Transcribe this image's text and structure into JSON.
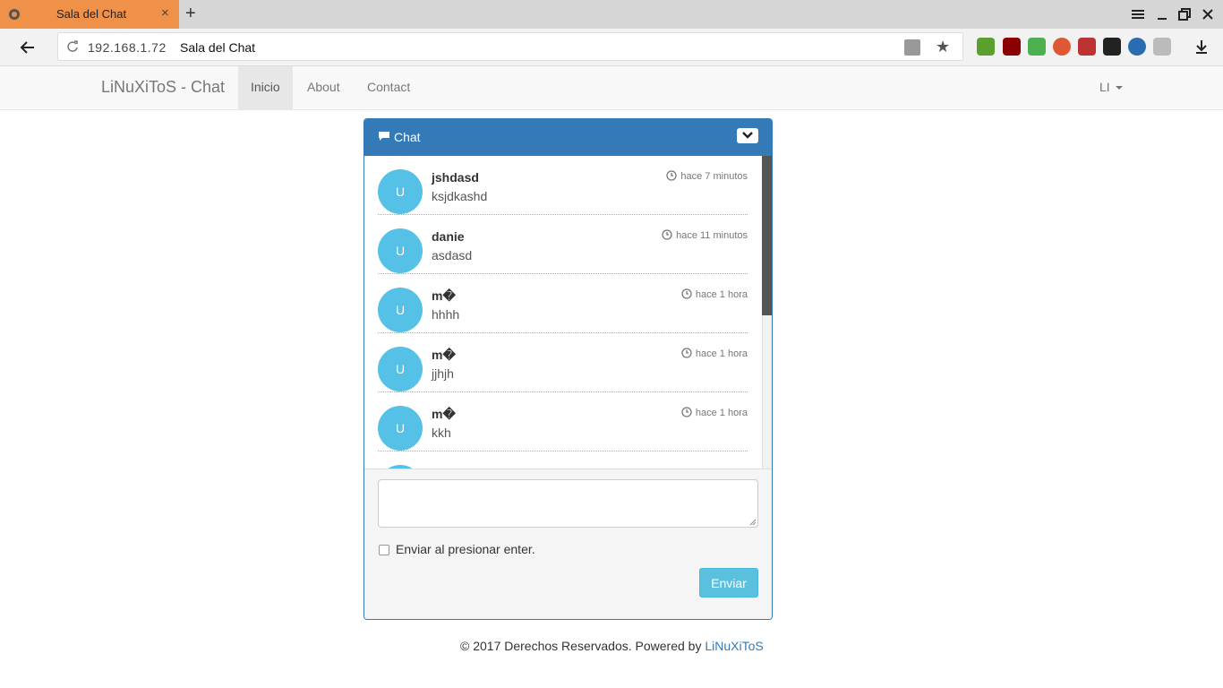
{
  "browser": {
    "tab_title": "Sala del Chat",
    "tab_close": "×",
    "new_tab": "+",
    "url_host": "192.168.1.72",
    "url_title": "Sala del Chat"
  },
  "navbar": {
    "brand": "LiNuXiToS - Chat",
    "items": [
      {
        "label": "Inicio",
        "active": true
      },
      {
        "label": "About",
        "active": false
      },
      {
        "label": "Contact",
        "active": false
      }
    ],
    "user": "LI"
  },
  "chat": {
    "title": "Chat",
    "messages": [
      {
        "avatar": "U",
        "user": "jshdasd",
        "text": "ksjdkashd",
        "time": "hace 7 minutos"
      },
      {
        "avatar": "U",
        "user": "danie",
        "text": "asdasd",
        "time": "hace 11 minutos"
      },
      {
        "avatar": "U",
        "user": "m�",
        "text": "hhhh",
        "time": "hace 1 hora"
      },
      {
        "avatar": "U",
        "user": "m�",
        "text": "jjhjh",
        "time": "hace 1 hora"
      },
      {
        "avatar": "U",
        "user": "m�",
        "text": "kkh",
        "time": "hace 1 hora"
      }
    ],
    "input_value": "",
    "enter_label": "Enviar al presionar enter.",
    "send_label": "Enviar"
  },
  "footer": {
    "text": "© 2017 Derechos Reservados. Powered by ",
    "link": "LiNuXiToS"
  },
  "colors": {
    "tab_active": "#f0914a",
    "panel_primary": "#337ab7",
    "avatar": "#55c1e7",
    "send_button": "#5bc0de"
  }
}
